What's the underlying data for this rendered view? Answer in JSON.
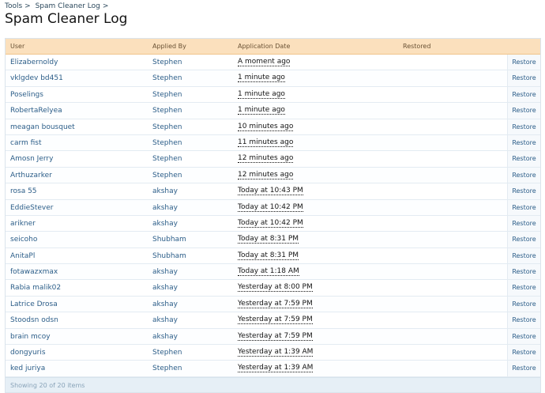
{
  "breadcrumb": {
    "items": [
      "Tools",
      "Spam Cleaner Log"
    ],
    "separator": ">"
  },
  "page_title": "Spam Cleaner Log",
  "table": {
    "headers": [
      "User",
      "Applied By",
      "Application Date",
      "Restored"
    ],
    "rows": [
      {
        "user": "Elizabernoldy",
        "by": "Stephen",
        "date": "A moment ago",
        "action": "Restore"
      },
      {
        "user": "vklgdev bd451",
        "by": "Stephen",
        "date": "1 minute ago",
        "action": "Restore"
      },
      {
        "user": "Poselings",
        "by": "Stephen",
        "date": "1 minute ago",
        "action": "Restore"
      },
      {
        "user": "RobertaRelyea",
        "by": "Stephen",
        "date": "1 minute ago",
        "action": "Restore"
      },
      {
        "user": "meagan bousquet",
        "by": "Stephen",
        "date": "10 minutes ago",
        "action": "Restore"
      },
      {
        "user": "carm fist",
        "by": "Stephen",
        "date": "11 minutes ago",
        "action": "Restore"
      },
      {
        "user": "Amosn Jerry",
        "by": "Stephen",
        "date": "12 minutes ago",
        "action": "Restore"
      },
      {
        "user": "Arthuzarker",
        "by": "Stephen",
        "date": "12 minutes ago",
        "action": "Restore"
      },
      {
        "user": "rosa 55",
        "by": "akshay",
        "date": "Today at 10:43 PM",
        "action": "Restore"
      },
      {
        "user": "EddieStever",
        "by": "akshay",
        "date": "Today at 10:42 PM",
        "action": "Restore"
      },
      {
        "user": "arikner",
        "by": "akshay",
        "date": "Today at 10:42 PM",
        "action": "Restore"
      },
      {
        "user": "seicoho",
        "by": "Shubham",
        "date": "Today at 8:31 PM",
        "action": "Restore"
      },
      {
        "user": "AnitaPl",
        "by": "Shubham",
        "date": "Today at 8:31 PM",
        "action": "Restore"
      },
      {
        "user": "fotawazxmax",
        "by": "akshay",
        "date": "Today at 1:18 AM",
        "action": "Restore"
      },
      {
        "user": "Rabia malik02",
        "by": "akshay",
        "date": "Yesterday at 8:00 PM",
        "action": "Restore"
      },
      {
        "user": "Latrice Drosa",
        "by": "akshay",
        "date": "Yesterday at 7:59 PM",
        "action": "Restore"
      },
      {
        "user": "Stoodsn odsn",
        "by": "akshay",
        "date": "Yesterday at 7:59 PM",
        "action": "Restore"
      },
      {
        "user": "brain mcoy",
        "by": "akshay",
        "date": "Yesterday at 7:59 PM",
        "action": "Restore"
      },
      {
        "user": "dongyuris",
        "by": "Stephen",
        "date": "Yesterday at 1:39 AM",
        "action": "Restore"
      },
      {
        "user": "ked juriya",
        "by": "Stephen",
        "date": "Yesterday at 1:39 AM",
        "action": "Restore"
      }
    ],
    "footer": "Showing 20 of 20 items"
  }
}
